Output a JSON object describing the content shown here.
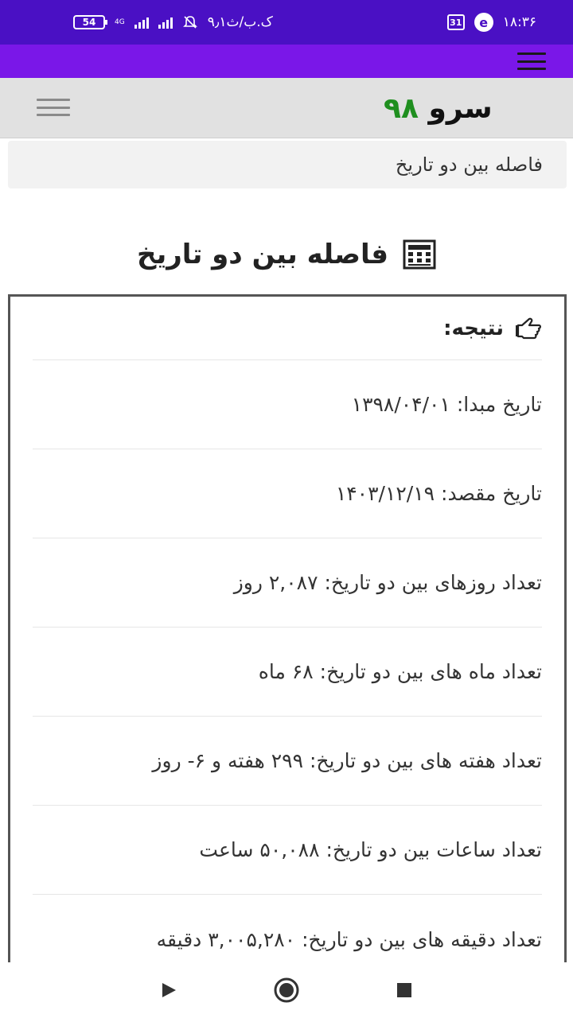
{
  "status_bar": {
    "battery": "54",
    "network": "4G",
    "speed": "۹٫۱ک.ب/ث",
    "calendar_day": "31",
    "app_badge": "e",
    "time": "۱۸:۳۶"
  },
  "header": {
    "logo_word": "سرو",
    "logo_number": "۹۸"
  },
  "breadcrumb": {
    "label": "فاصله بین دو تاریخ"
  },
  "page": {
    "title": "فاصله بین دو تاریخ"
  },
  "result": {
    "label": "نتیجه:",
    "items": [
      "تاریخ مبدا: ۱۳۹۸/۰۴/۰۱",
      "تاریخ مقصد: ۱۴۰۳/۱۲/۱۹",
      "تعداد روزهای بین دو تاریخ: ۲,۰۸۷ روز",
      "تعداد ماه های بین دو تاریخ: ۶۸ ماه",
      "تعداد هفته های بین دو تاریخ: ۲۹۹ هفته و ۶- روز",
      "تعداد ساعات بین دو تاریخ: ۵۰,۰۸۸ ساعت",
      "تعداد دقیقه های بین دو تاریخ: ۳,۰۰۵,۲۸۰ دقیقه"
    ]
  },
  "colors": {
    "status_bar": "#4a10c4",
    "app_bar": "#7a17e8",
    "logo_number": "#1f8f1f"
  },
  "icons": {
    "title": "calculator-icon",
    "result": "hand-point-icon",
    "nav_back": "triangle-play-icon",
    "nav_home": "circle-home-icon",
    "nav_recents": "square-recents-icon"
  }
}
